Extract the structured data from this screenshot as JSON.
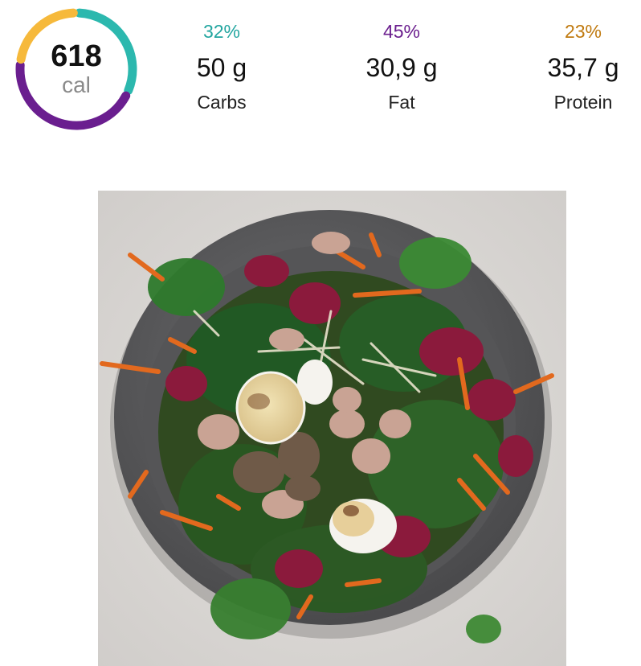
{
  "summary": {
    "calories": {
      "value": "618",
      "unit": "cal"
    },
    "macros": [
      {
        "percent": "32%",
        "amount": "50 g",
        "name": "Carbs",
        "color": "#23a6a0",
        "fraction": 0.32
      },
      {
        "percent": "45%",
        "amount": "30,9 g",
        "name": "Fat",
        "color": "#6b1f8e",
        "fraction": 0.45
      },
      {
        "percent": "23%",
        "amount": "35,7 g",
        "name": "Protein",
        "color": "#c07a10",
        "fraction": 0.23
      }
    ],
    "ring_colors": {
      "carbs": "#2cb8ae",
      "fat": "#6a1e8f",
      "protein": "#f6b93b"
    }
  },
  "photo": {
    "subject": "salad-bowl"
  }
}
